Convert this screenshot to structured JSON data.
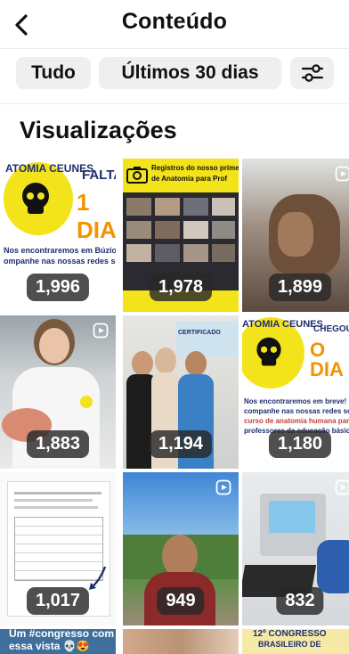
{
  "header": {
    "title": "Conteúdo"
  },
  "filters": {
    "all": "Tudo",
    "period": "Últimos 30 dias"
  },
  "section": {
    "title": "Visualizações"
  },
  "tiles": [
    {
      "views": "1,996",
      "word1": "ATOMIA CEUNES",
      "word2": "FALTA",
      "word3": "1 DIA",
      "caption": "Nos encontraremos em Búzios",
      "caption2": "ompanhe nas nossas redes soc"
    },
    {
      "views": "1,978",
      "line1": "Registros do nosso primeiro",
      "line2": "de Anatomia para Prof"
    },
    {
      "views": "1,899"
    },
    {
      "views": "1,883"
    },
    {
      "views": "1,194",
      "banner": "CERTIFICADO"
    },
    {
      "views": "1,180",
      "logo": "ATOMIA CEUNES",
      "chegou": "CHEGOU",
      "big": "O DIA",
      "cap1": "Nos encontraremos em breve!",
      "cap2": "companhe nas nossas redes soci",
      "cap3": "curso de anatomia humana para",
      "cap4": "professores da educação básica"
    },
    {
      "views": "1,017"
    },
    {
      "views": "949"
    },
    {
      "views": "832"
    },
    {
      "caption": "Um #congresso com",
      "caption2": "essa vista 💀😍"
    },
    {},
    {
      "caption": "12º CONGRESSO",
      "caption2": "BRASILEIRO DE"
    }
  ],
  "colors": {
    "accent_yellow": "#f2e31a",
    "accent_orange": "#f29400",
    "navy": "#1e2f6e"
  }
}
